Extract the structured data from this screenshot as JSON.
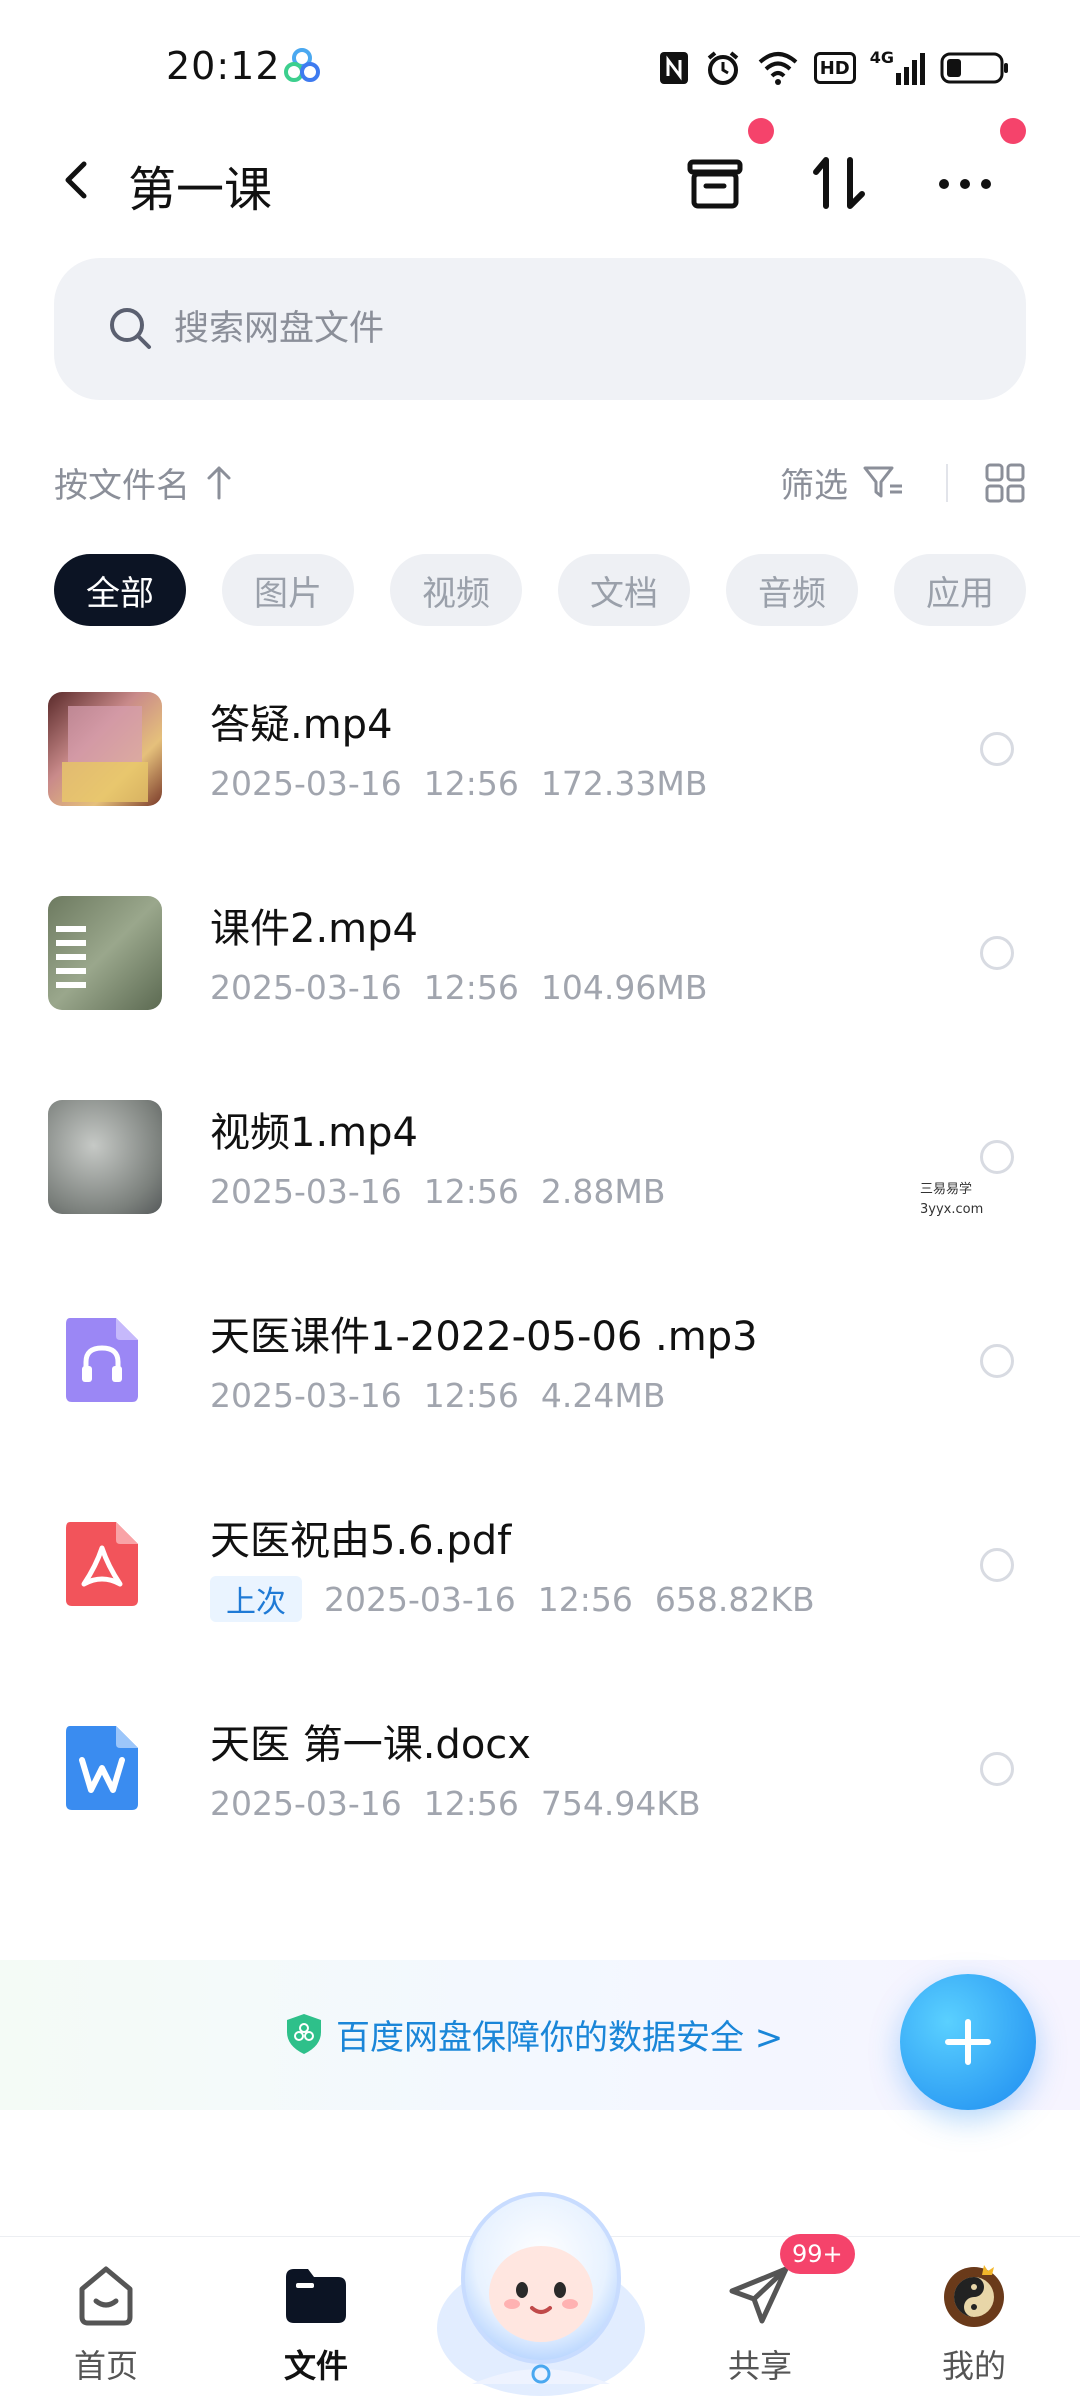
{
  "status_bar": {
    "time": "20:12",
    "icons": [
      "nfc-icon",
      "alarm-icon",
      "wifi-icon",
      "hd-icon",
      "signal-4g-icon",
      "battery-icon"
    ],
    "hd_label": "HD",
    "signal_label": "4G"
  },
  "header": {
    "title": "第一课",
    "icons": [
      "back-icon",
      "archive-icon",
      "transfer-icon",
      "more-icon"
    ]
  },
  "search": {
    "placeholder": "搜索网盘文件"
  },
  "sort_row": {
    "sort_label": "按文件名",
    "filter_label": "筛选"
  },
  "chips": [
    {
      "label": "全部",
      "active": true
    },
    {
      "label": "图片",
      "active": false
    },
    {
      "label": "视频",
      "active": false
    },
    {
      "label": "文档",
      "active": false
    },
    {
      "label": "音频",
      "active": false
    },
    {
      "label": "应用",
      "active": false
    }
  ],
  "files": [
    {
      "name": "答疑.mp4",
      "date": "2025-03-16",
      "time": "12:56",
      "size": "172.33MB",
      "kind": "video"
    },
    {
      "name": "课件2.mp4",
      "date": "2025-03-16",
      "time": "12:56",
      "size": "104.96MB",
      "kind": "video"
    },
    {
      "name": "视频1.mp4",
      "date": "2025-03-16",
      "time": "12:56",
      "size": "2.88MB",
      "kind": "video"
    },
    {
      "name": "天医课件1-2022-05-06 .mp3",
      "date": "2025-03-16",
      "time": "12:56",
      "size": "4.24MB",
      "kind": "audio"
    },
    {
      "name": "天医祝由5.6.pdf",
      "badge": "上次",
      "date": "2025-03-16",
      "time": "12:56",
      "size": "658.82KB",
      "kind": "pdf"
    },
    {
      "name": "天医 第一课.docx",
      "date": "2025-03-16",
      "time": "12:56",
      "size": "754.94KB",
      "kind": "word"
    }
  ],
  "watermark": {
    "line1": "三易易学",
    "line2": "3yyx.com"
  },
  "security_banner": {
    "text": "百度网盘保障你的数据安全 >"
  },
  "bottom_nav": {
    "items": [
      {
        "label": "首页",
        "active": false
      },
      {
        "label": "文件",
        "active": true
      },
      {
        "label": "共享",
        "active": false
      },
      {
        "label": "我的",
        "active": false
      }
    ],
    "share_badge": "99+"
  },
  "colors": {
    "accent_blue": "#1d8bf0",
    "red_dot": "#f5436b",
    "chip_active_bg": "#0c1424"
  }
}
